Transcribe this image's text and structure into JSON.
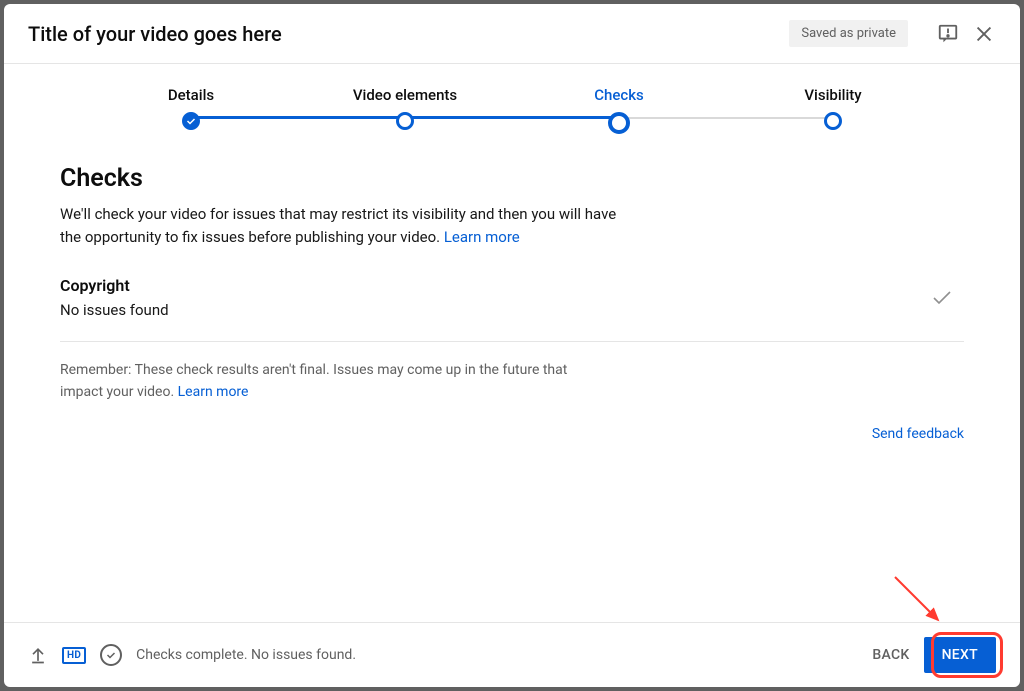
{
  "header": {
    "title": "Title of your video goes here",
    "save_status": "Saved as private"
  },
  "stepper": {
    "steps": [
      {
        "label": "Details"
      },
      {
        "label": "Video elements"
      },
      {
        "label": "Checks"
      },
      {
        "label": "Visibility"
      }
    ]
  },
  "checks": {
    "title": "Checks",
    "description": "We'll check your video for issues that may restrict its visibility and then you will have the opportunity to fix issues before publishing your video. ",
    "learn_more": "Learn more",
    "copyright": {
      "title": "Copyright",
      "status": "No issues found"
    },
    "note_text": "Remember: These check results aren't final. Issues may come up in the future that impact your video. ",
    "note_learn_more": "Learn more",
    "send_feedback": "Send feedback"
  },
  "footer": {
    "status_text": "Checks complete. No issues found.",
    "hd_label": "HD",
    "back_label": "BACK",
    "next_label": "NEXT"
  },
  "colors": {
    "primary": "#065fd4",
    "highlight": "#ff3b30"
  }
}
